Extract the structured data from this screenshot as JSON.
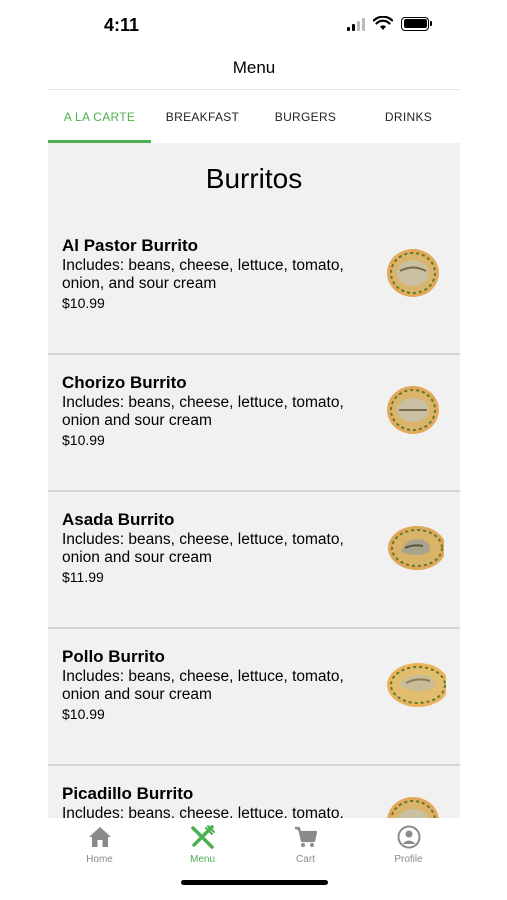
{
  "status_bar": {
    "time": "4:11"
  },
  "header": {
    "title": "Menu"
  },
  "tabs": [
    {
      "label": "A LA CARTE",
      "active": true
    },
    {
      "label": "BREAKFAST",
      "active": false
    },
    {
      "label": "BURGERS",
      "active": false
    },
    {
      "label": "DRINKS",
      "active": false
    }
  ],
  "section": {
    "title": "Burritos"
  },
  "items": [
    {
      "name": "Al Pastor Burrito",
      "description": "Includes: beans, cheese, lettuce, tomato, onion, and sour cream",
      "price": "$10.99"
    },
    {
      "name": "Chorizo Burrito",
      "description": "Includes: beans, cheese, lettuce, tomato, onion and sour cream",
      "price": "$10.99"
    },
    {
      "name": "Asada Burrito",
      "description": "Includes: beans, cheese, lettuce, tomato, onion and sour cream",
      "price": "$11.99"
    },
    {
      "name": "Pollo Burrito",
      "description": "Includes: beans, cheese, lettuce, tomato, onion and sour cream",
      "price": "$10.99"
    },
    {
      "name": "Picadillo Burrito",
      "description": "Includes: beans, cheese, lettuce, tomato,",
      "price": ""
    }
  ],
  "tab_bar": [
    {
      "label": "Home",
      "icon": "home-icon",
      "active": false
    },
    {
      "label": "Menu",
      "icon": "utensils-icon",
      "active": true
    },
    {
      "label": "Cart",
      "icon": "cart-icon",
      "active": false
    },
    {
      "label": "Profile",
      "icon": "profile-icon",
      "active": false
    }
  ],
  "colors": {
    "accent": "#4caf50",
    "list_bg": "#f1f1f1",
    "inactive": "#8a8a8a"
  }
}
